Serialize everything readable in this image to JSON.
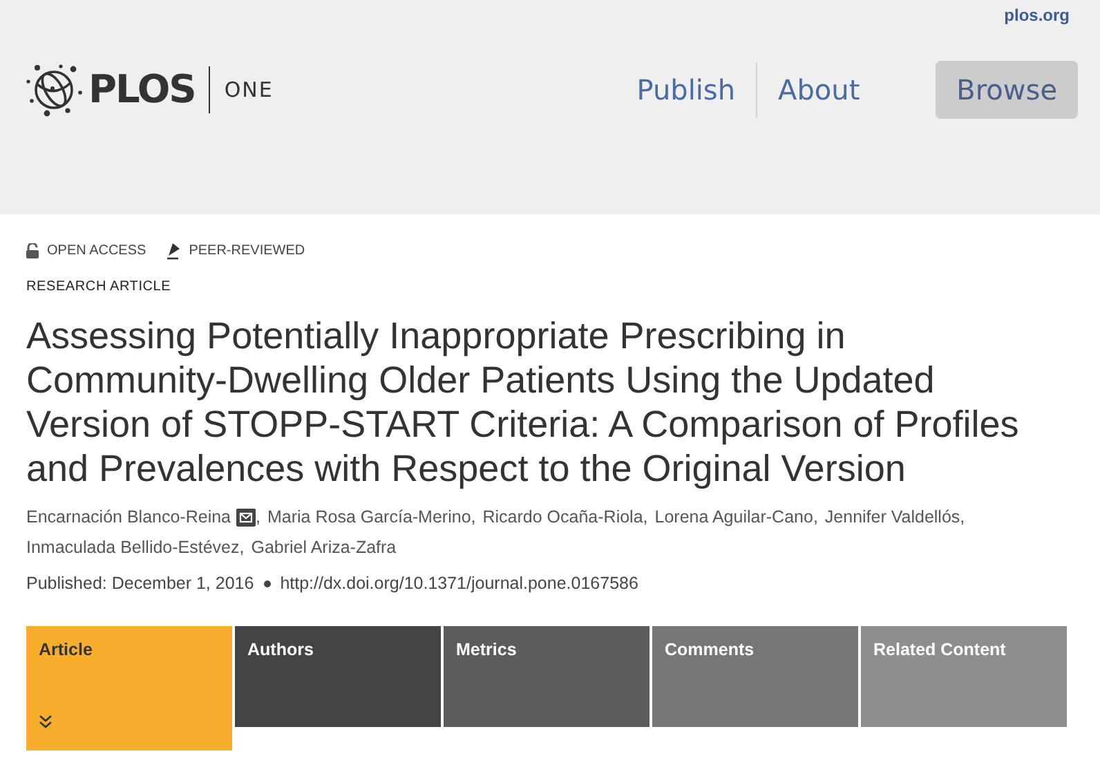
{
  "header": {
    "site_link": "plos.org",
    "logo": {
      "brand": "PLOS",
      "journal": "ONE"
    },
    "nav": [
      {
        "label": "Publish",
        "selected": false
      },
      {
        "label": "About",
        "selected": false
      },
      {
        "label": "Browse",
        "selected": true
      }
    ]
  },
  "badges": [
    {
      "kind": "open",
      "label": "OPEN ACCESS"
    },
    {
      "kind": "peer",
      "label": "PEER-REVIEWED"
    }
  ],
  "article_type": "RESEARCH ARTICLE",
  "title": "Assessing Potentially Inappropriate Prescribing in Community-Dwelling Older Patients Using the Updated Version of STOPP-START Criteria: A Comparison of Profiles and Prevalences with Respect to the Original Version",
  "authors": [
    {
      "name": "Encarnación Blanco-Reina",
      "corresponding": true,
      "separator": ","
    },
    {
      "name": "Maria Rosa García-Merino",
      "corresponding": false,
      "separator": ","
    },
    {
      "name": "Ricardo Ocaña-Riola",
      "corresponding": false,
      "separator": ","
    },
    {
      "name": "Lorena Aguilar-Cano",
      "corresponding": false,
      "separator": ","
    },
    {
      "name": "Jennifer Valdellós",
      "corresponding": false,
      "separator": ","
    },
    {
      "name": "Inmaculada Bellido-Estévez",
      "corresponding": false,
      "separator": ","
    },
    {
      "name": "Gabriel Ariza-Zafra",
      "corresponding": false
    }
  ],
  "published": "Published: December 1, 2016",
  "doi": "http://dx.doi.org/10.1371/journal.pone.0167586",
  "tabs": [
    {
      "label": "Article",
      "selected": true,
      "color": "#f8ae2c"
    },
    {
      "label": "Authors",
      "selected": false,
      "color": "#444444"
    },
    {
      "label": "Metrics",
      "selected": false,
      "color": "#5c5c5c"
    },
    {
      "label": "Comments",
      "selected": false,
      "color": "#777777"
    },
    {
      "label": "Related Content",
      "selected": false,
      "color": "#8e8e8e"
    }
  ]
}
